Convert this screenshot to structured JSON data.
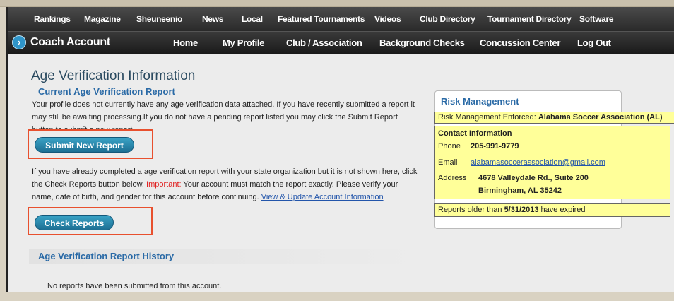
{
  "nav_top": {
    "items": [
      "Rankings",
      "Magazine",
      "Sheuneenio",
      "News",
      "Local",
      "Featured Tournaments",
      "Videos",
      "Club Directory",
      "Tournament Directory",
      "Software"
    ]
  },
  "nav_main": {
    "brand": "Coach Account",
    "brand_icon": "circle-arrow-icon",
    "items": [
      "Home",
      "My Profile",
      "Club / Association",
      "Background Checks",
      "Concussion Center",
      "Log Out"
    ]
  },
  "page": {
    "title": "Age Verification Information",
    "current_heading": "Current Age Verification Report",
    "current_text_1": "Your profile does not currently have any age verification data attached. If you have recently submitted a report it",
    "current_text_2": "may still be awaiting processing.If you do not have a pending report listed you may click the Submit Report",
    "current_text_3": "button to submit a new report.",
    "submit_button": "Submit New Report",
    "check_text_1": "If you have already completed a age verification report with your state organization but it is not shown here, click",
    "check_text_2a": "the Check Reports button below. ",
    "check_important": "Important:",
    "check_text_2b": " Your account must match the report exactly. Please verify your",
    "check_text_3": "name, date of birth, and gender for this account before continuing. ",
    "check_link": "View & Update Account Information",
    "check_button": "Check Reports",
    "history_heading": "Age Verification Report History",
    "history_empty": "No reports have been submitted from this account."
  },
  "risk": {
    "title": "Risk Management",
    "enforced_label": "Risk Management Enforced: ",
    "enforced_value": "Alabama Soccer Association (AL)",
    "contact_heading": "Contact Information",
    "phone_label": "Phone",
    "phone_value": "205-991-9779",
    "email_label": "Email",
    "email_value": "alabamasoccerassociation@gmail.com",
    "address_label": "Address",
    "address_line1": "4678 Valleydale Rd., Suite 200",
    "address_line2": "Birmingham, AL 35242",
    "expired_prefix": "Reports older than ",
    "expired_date": "5/31/2013",
    "expired_suffix": " have expired"
  },
  "colors": {
    "accent": "#2a6aa6",
    "button": "#1d6f93",
    "highlight": "#ffff99",
    "annotation": "#e8502e",
    "warning": "#e02020"
  }
}
